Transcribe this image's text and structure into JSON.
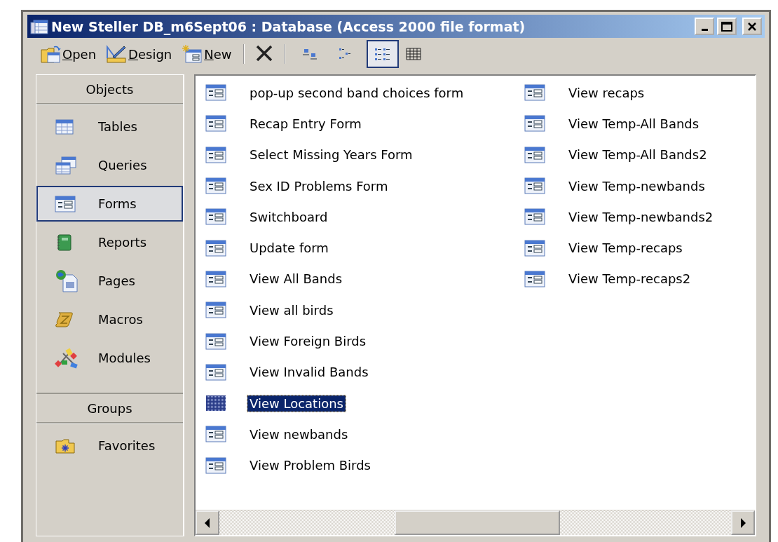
{
  "window": {
    "title": "New Steller DB_m6Sept06 : Database (Access 2000 file format)"
  },
  "toolbar": {
    "commands": [
      {
        "kind": "open",
        "label": "Open"
      },
      {
        "kind": "design",
        "label": "Design"
      },
      {
        "kind": "new",
        "label": "New"
      }
    ],
    "views": [
      {
        "kind": "large",
        "selected": false
      },
      {
        "kind": "small",
        "selected": false
      },
      {
        "kind": "list",
        "selected": true
      },
      {
        "kind": "details",
        "selected": false
      }
    ]
  },
  "sidebar": {
    "sections": [
      {
        "header": "Objects",
        "items": [
          {
            "kind": "tables",
            "label": "Tables",
            "selected": false
          },
          {
            "kind": "queries",
            "label": "Queries",
            "selected": false
          },
          {
            "kind": "forms",
            "label": "Forms",
            "selected": true
          },
          {
            "kind": "reports",
            "label": "Reports",
            "selected": false
          },
          {
            "kind": "pages",
            "label": "Pages",
            "selected": false
          },
          {
            "kind": "macros",
            "label": "Macros",
            "selected": false
          },
          {
            "kind": "modules",
            "label": "Modules",
            "selected": false
          }
        ]
      },
      {
        "header": "Groups",
        "items": [
          {
            "kind": "favorites",
            "label": "Favorites",
            "selected": false
          }
        ]
      }
    ]
  },
  "list": {
    "items": [
      {
        "label": "pop-up second band choices form",
        "selected": false
      },
      {
        "label": "Recap Entry Form",
        "selected": false
      },
      {
        "label": "Select Missing Years Form",
        "selected": false
      },
      {
        "label": "Sex ID Problems Form",
        "selected": false
      },
      {
        "label": "Switchboard",
        "selected": false
      },
      {
        "label": "Update form",
        "selected": false
      },
      {
        "label": "View All Bands",
        "selected": false
      },
      {
        "label": "View all birds",
        "selected": false
      },
      {
        "label": "View Foreign Birds",
        "selected": false
      },
      {
        "label": "View Invalid Bands",
        "selected": false
      },
      {
        "label": "View Locations",
        "selected": true
      },
      {
        "label": "View newbands",
        "selected": false
      },
      {
        "label": "View Problem Birds",
        "selected": false
      },
      {
        "label": "View recaps",
        "selected": false
      },
      {
        "label": "View Temp-All Bands",
        "selected": false
      },
      {
        "label": "View Temp-All Bands2",
        "selected": false
      },
      {
        "label": "View Temp-newbands",
        "selected": false
      },
      {
        "label": "View Temp-newbands2",
        "selected": false
      },
      {
        "label": "View Temp-recaps",
        "selected": false
      },
      {
        "label": "View Temp-recaps2",
        "selected": false
      }
    ]
  }
}
